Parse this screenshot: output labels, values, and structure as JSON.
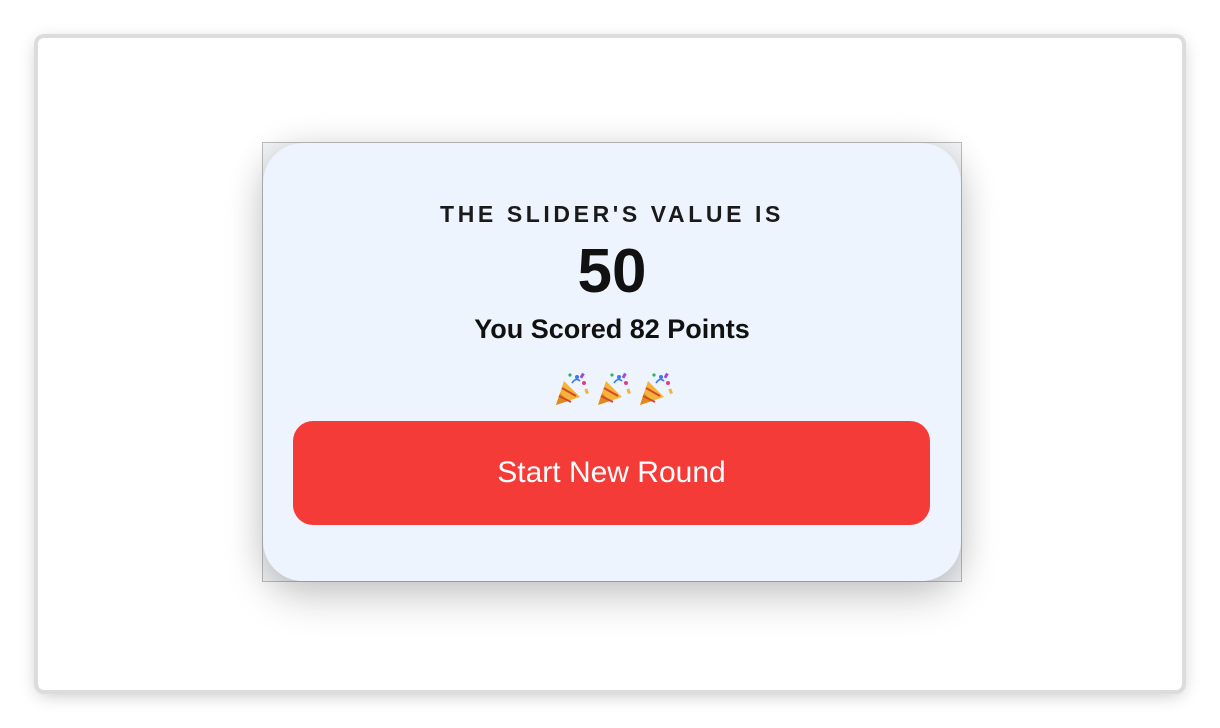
{
  "result_card": {
    "heading": "THE SLIDER'S VALUE IS",
    "slider_value": "50",
    "score_text": "You Scored 82 Points",
    "celebration_icons": [
      "party-popper-icon",
      "party-popper-icon",
      "party-popper-icon"
    ],
    "button_label": "Start New Round"
  },
  "colors": {
    "card_background": "#eef4fd",
    "button_background": "#f43b38",
    "button_text": "#ffffff",
    "text": "#111111"
  }
}
